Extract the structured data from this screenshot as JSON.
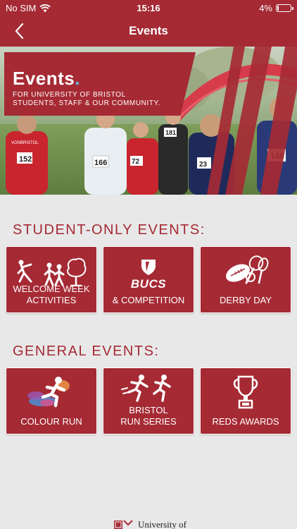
{
  "status_bar": {
    "carrier": "No SIM",
    "time": "15:16",
    "battery": "4%",
    "battery_level": 0.04
  },
  "nav": {
    "title": "Events"
  },
  "hero": {
    "title": "Events",
    "dot": ".",
    "subtitle_line1": "FOR UNIVERSITY OF BRISTOL",
    "subtitle_line2": "STUDENTS, STAFF & OUR COMMUNITY.",
    "bibs": [
      "152",
      "166",
      "72",
      "181",
      "146",
      "23"
    ],
    "shirt_text": "VONBRISTOL"
  },
  "sections": {
    "student": {
      "title": "STUDENT-ONLY EVENTS:",
      "tiles": [
        {
          "label_line1": "WELCOME WEEK",
          "label_line2": "ACTIVITIES"
        },
        {
          "logo_text": "BUCS",
          "label_line1": "& COMPETITION",
          "label_line2": ""
        },
        {
          "label_line1": "DERBY DAY",
          "label_line2": ""
        }
      ]
    },
    "general": {
      "title": "GENERAL EVENTS:",
      "tiles": [
        {
          "label_line1": "COLOUR RUN",
          "label_line2": ""
        },
        {
          "label_line1": "BRISTOL",
          "label_line2": "RUN SERIES"
        },
        {
          "label_line1": "REDS AWARDS",
          "label_line2": ""
        }
      ]
    }
  },
  "footer": {
    "logo_text": "University of"
  },
  "colors": {
    "brand_red": "#a52a34",
    "accent_blue": "#5bc0e8",
    "background": "#e8e8e8"
  },
  "icons": [
    "wifi-icon",
    "battery-icon",
    "back-chevron-icon",
    "stretching-person-icon",
    "people-with-tree-icon",
    "bucs-shield-icon",
    "rugby-tennis-badminton-icon",
    "colour-runner-icon",
    "two-runners-icon",
    "trophy-icon",
    "university-crest-icon"
  ]
}
